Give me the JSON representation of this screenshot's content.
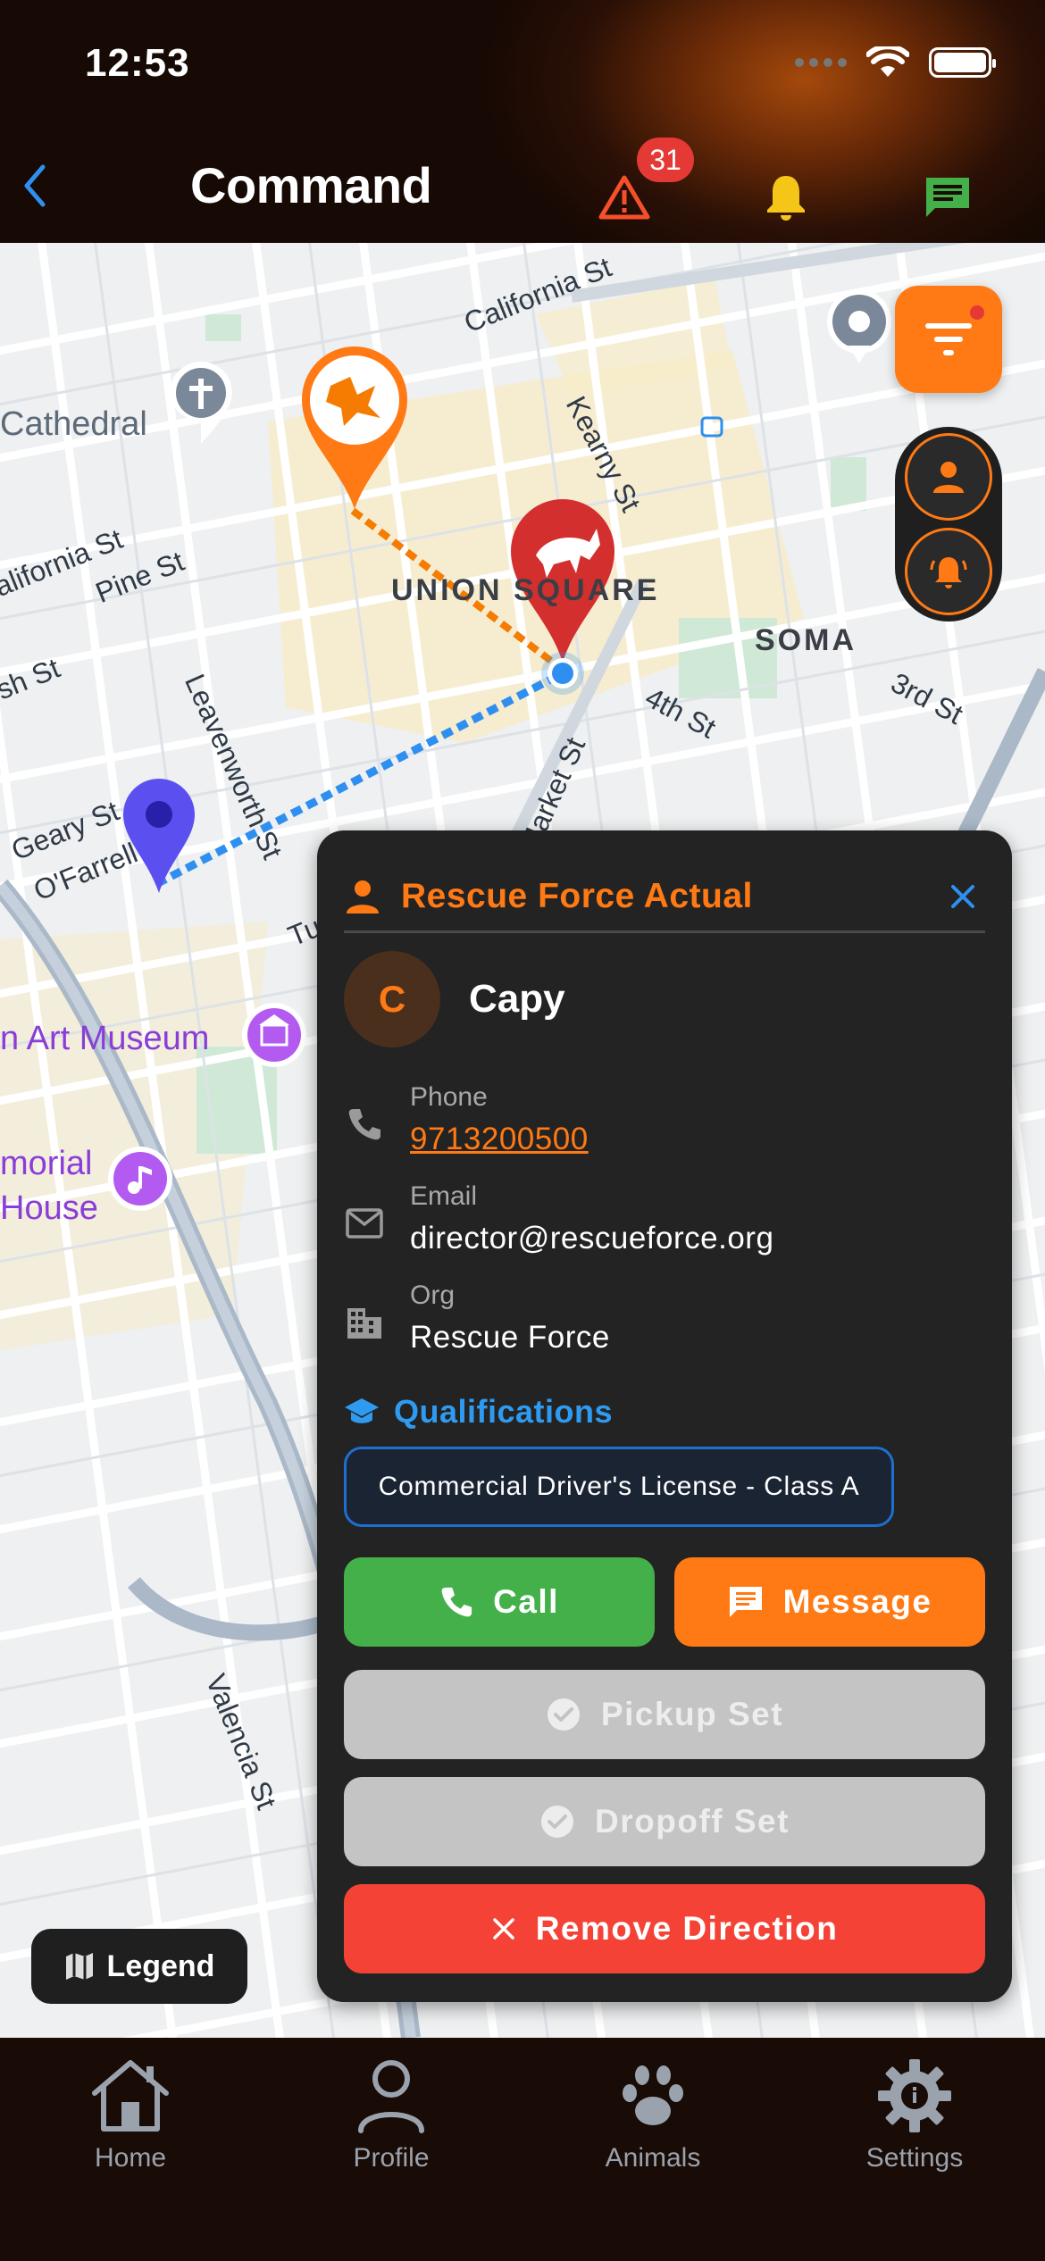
{
  "status_bar": {
    "time": "12:53"
  },
  "header": {
    "title": "Command",
    "alert_count": "31"
  },
  "map": {
    "labels": {
      "california_st": "California St",
      "california_st_left": "alifornia St",
      "pine_st": "Pine St",
      "bush_st": "sh St",
      "kearny_st": "Kearny St",
      "union_square": "UNION SQUARE",
      "soma": "SOMA",
      "third_st": "3rd St",
      "fourth_st": "4th St",
      "leavenworth_st": "Leavenworth St",
      "geary_st": "Geary St",
      "ofarrell": "O'Farrell",
      "market_st": "Market St",
      "turk": "Turk",
      "valencia_st": "Valencia St",
      "cathedral": "Cathedral",
      "art_museum": "n Art Museum",
      "memorial": "morial",
      "house": "House"
    }
  },
  "legend": {
    "label": "Legend"
  },
  "card": {
    "title": "Rescue Force Actual",
    "person": {
      "initial": "C",
      "name": "Capy"
    },
    "phone": {
      "label": "Phone",
      "value": "9713200500"
    },
    "email": {
      "label": "Email",
      "value": "director@rescueforce.org"
    },
    "org": {
      "label": "Org",
      "value": "Rescue Force"
    },
    "qualifications_title": "Qualifications",
    "qualifications": [
      "Commercial Driver's License - Class A"
    ],
    "buttons": {
      "call": "Call",
      "message": "Message",
      "pickup": "Pickup Set",
      "dropoff": "Dropoff Set",
      "remove": "Remove Direction"
    }
  },
  "nav": {
    "home": "Home",
    "profile": "Profile",
    "animals": "Animals",
    "settings": "Settings"
  },
  "colors": {
    "accent": "#ff7a14",
    "call_green": "#43b04a",
    "remove_red": "#f44336",
    "qual_blue": "#2f9bf0",
    "alert_yellow": "#f5c518",
    "chat_green": "#43b04a"
  }
}
